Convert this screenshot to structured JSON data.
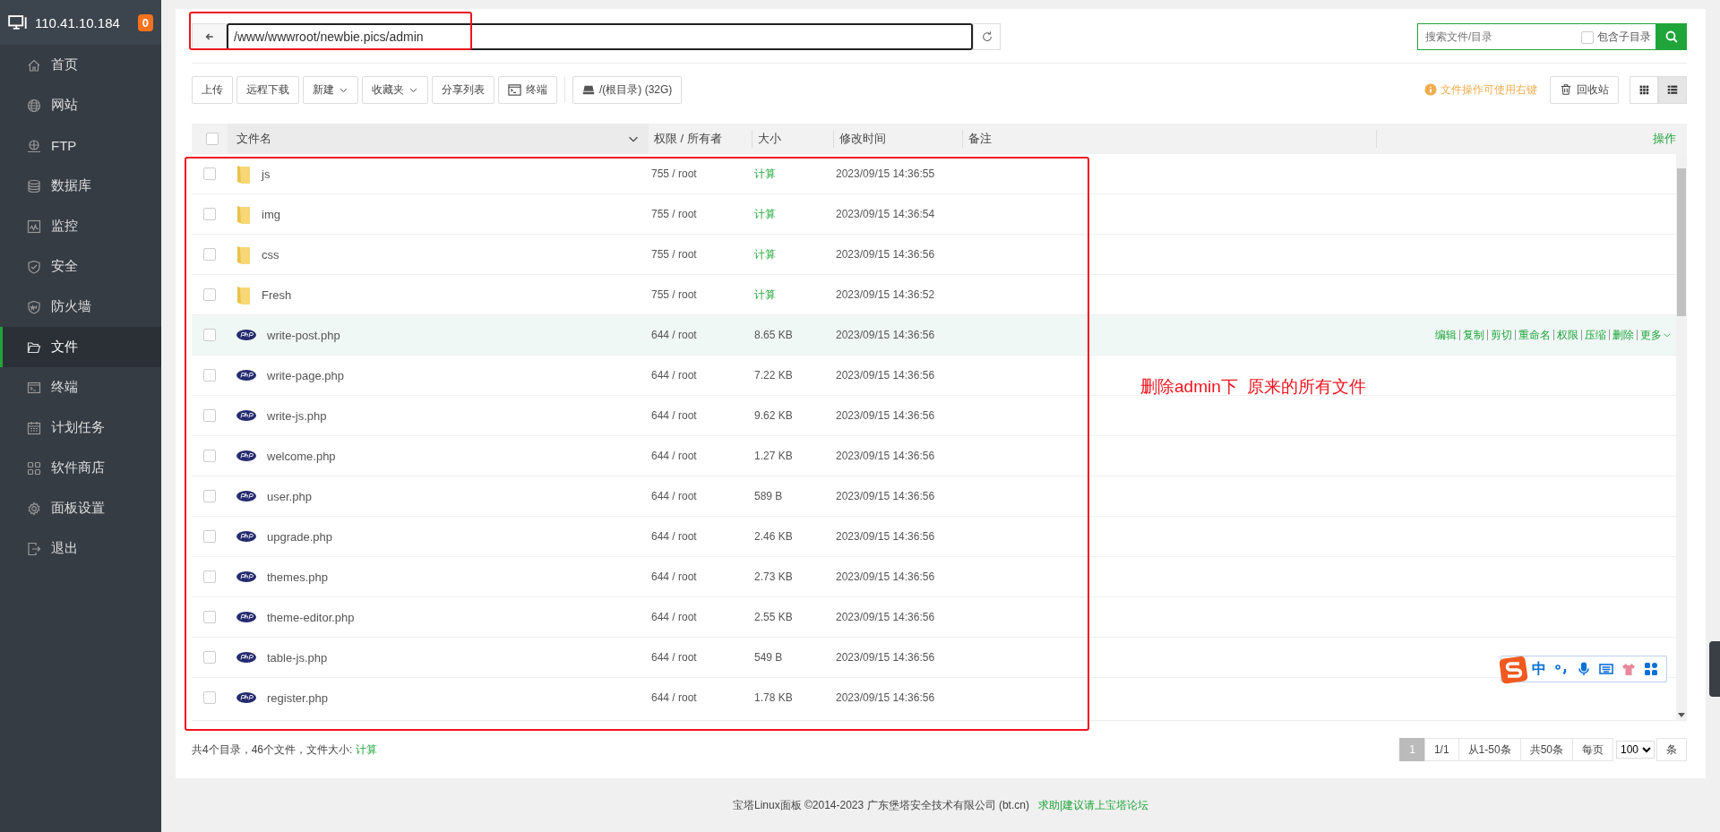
{
  "sidebar": {
    "host": "110.41.10.184",
    "badge": "0",
    "items": [
      {
        "label": "首页",
        "selected": false
      },
      {
        "label": "网站",
        "selected": false
      },
      {
        "label": "FTP",
        "selected": false
      },
      {
        "label": "数据库",
        "selected": false
      },
      {
        "label": "监控",
        "selected": false
      },
      {
        "label": "安全",
        "selected": false
      },
      {
        "label": "防火墙",
        "selected": false
      },
      {
        "label": "文件",
        "selected": true
      },
      {
        "label": "终端",
        "selected": false
      },
      {
        "label": "计划任务",
        "selected": false
      },
      {
        "label": "软件商店",
        "selected": false
      },
      {
        "label": "面板设置",
        "selected": false
      },
      {
        "label": "退出",
        "selected": false
      }
    ]
  },
  "path_bar": {
    "value": "/www/wwwroot/newbie.pics/admin"
  },
  "search": {
    "placeholder": "搜索文件/目录",
    "include_subdirs": {
      "label": "包含子目录",
      "checked": false
    }
  },
  "toolbar": {
    "buttons": [
      {
        "kind": "plain",
        "label": "上传"
      },
      {
        "kind": "plain",
        "label": "远程下载"
      },
      {
        "kind": "dropdown",
        "label": "新建"
      },
      {
        "kind": "dropdown",
        "label": "收藏夹"
      },
      {
        "kind": "plain",
        "label": "分享列表"
      },
      {
        "kind": "terminal",
        "label": "终端"
      },
      {
        "kind": "disk",
        "label": "/(根目录) (32G)"
      }
    ],
    "hint": "文件操作可使用右键",
    "recycle": "回收站",
    "view_modes": [
      {
        "kind": "grid",
        "selected": false
      },
      {
        "kind": "list",
        "selected": true
      }
    ]
  },
  "table": {
    "select_all": {
      "checked": false
    },
    "columns": [
      "文件名",
      "权限 / 所有者",
      "大小",
      "修改时间",
      "备注",
      "操作"
    ],
    "rows": [
      {
        "kind": "folder",
        "name": "js",
        "permission": "755 / root",
        "size": "计算",
        "modified": "2023/09/15 14:36:55",
        "checked": false,
        "highlighted": false
      },
      {
        "kind": "folder",
        "name": "img",
        "permission": "755 / root",
        "size": "计算",
        "modified": "2023/09/15 14:36:54",
        "checked": false,
        "highlighted": false
      },
      {
        "kind": "folder",
        "name": "css",
        "permission": "755 / root",
        "size": "计算",
        "modified": "2023/09/15 14:36:56",
        "checked": false,
        "highlighted": false
      },
      {
        "kind": "folder",
        "name": "Fresh",
        "permission": "755 / root",
        "size": "计算",
        "modified": "2023/09/15 14:36:52",
        "checked": false,
        "highlighted": false
      },
      {
        "kind": "php",
        "name": "write-post.php",
        "permission": "644 / root",
        "size": "8.65 KB",
        "modified": "2023/09/15 14:36:56",
        "checked": false,
        "highlighted": true,
        "actions": [
          {
            "label": "编辑",
            "caret": false
          },
          {
            "label": "复制",
            "caret": false
          },
          {
            "label": "剪切",
            "caret": false
          },
          {
            "label": "重命名",
            "caret": false
          },
          {
            "label": "权限",
            "caret": false
          },
          {
            "label": "压缩",
            "caret": false
          },
          {
            "label": "删除",
            "caret": false
          },
          {
            "label": "更多",
            "caret": true
          }
        ]
      },
      {
        "kind": "php",
        "name": "write-page.php",
        "permission": "644 / root",
        "size": "7.22 KB",
        "modified": "2023/09/15 14:36:56",
        "checked": false,
        "highlighted": false
      },
      {
        "kind": "php",
        "name": "write-js.php",
        "permission": "644 / root",
        "size": "9.62 KB",
        "modified": "2023/09/15 14:36:56",
        "checked": false,
        "highlighted": false
      },
      {
        "kind": "php",
        "name": "welcome.php",
        "permission": "644 / root",
        "size": "1.27 KB",
        "modified": "2023/09/15 14:36:56",
        "checked": false,
        "highlighted": false
      },
      {
        "kind": "php",
        "name": "user.php",
        "permission": "644 / root",
        "size": "589 B",
        "modified": "2023/09/15 14:36:56",
        "checked": false,
        "highlighted": false
      },
      {
        "kind": "php",
        "name": "upgrade.php",
        "permission": "644 / root",
        "size": "2.46 KB",
        "modified": "2023/09/15 14:36:56",
        "checked": false,
        "highlighted": false
      },
      {
        "kind": "php",
        "name": "themes.php",
        "permission": "644 / root",
        "size": "2.73 KB",
        "modified": "2023/09/15 14:36:56",
        "checked": false,
        "highlighted": false
      },
      {
        "kind": "php",
        "name": "theme-editor.php",
        "permission": "644 / root",
        "size": "2.55 KB",
        "modified": "2023/09/15 14:36:56",
        "checked": false,
        "highlighted": false
      },
      {
        "kind": "php",
        "name": "table-js.php",
        "permission": "644 / root",
        "size": "549 B",
        "modified": "2023/09/15 14:36:56",
        "checked": false,
        "highlighted": false
      },
      {
        "kind": "php",
        "name": "register.php",
        "permission": "644 / root",
        "size": "1.78 KB",
        "modified": "2023/09/15 14:36:56",
        "checked": false,
        "highlighted": false
      }
    ]
  },
  "summary": {
    "text": "共4个目录，46个文件，文件大小:",
    "link": "计算"
  },
  "pagination": {
    "pages": [
      {
        "label": "1",
        "selected": true
      }
    ],
    "page_info": "1/1",
    "range": "从1-50条",
    "total": "共50条",
    "per_page_label": "每页",
    "per_page": "100",
    "unit": "条"
  },
  "footer": {
    "copyright": "宝塔Linux面板 ©2014-2023 广东堡塔安全技术有限公司 (bt.cn)",
    "link": "求助|建议请上宝塔论坛"
  },
  "annotation": {
    "note": "删除admin下  原来的所有文件"
  },
  "ime_toolbar": {
    "mode": "中"
  }
}
